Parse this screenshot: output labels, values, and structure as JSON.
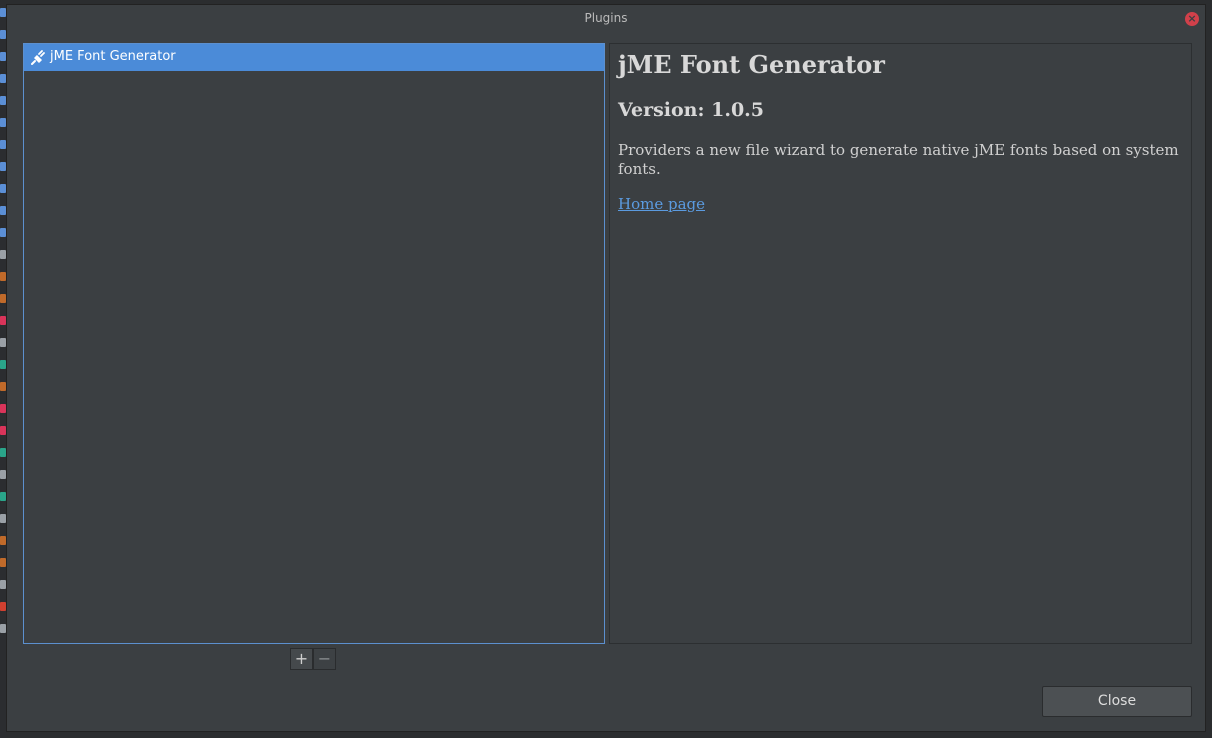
{
  "window": {
    "title": "Plugins",
    "close_icon_glyph": "×"
  },
  "plugin_list": {
    "items": [
      {
        "label": "jME Font Generator",
        "icon": "plug-icon",
        "selected": true
      }
    ]
  },
  "details": {
    "name": "jME Font Generator",
    "version": "Version: 1.0.5",
    "description": "Providers a new file wizard to generate native jME fonts based on system fonts.",
    "home_link": "Home page"
  },
  "toolbar": {
    "add_label": "+",
    "remove_label": "−"
  },
  "footer": {
    "close_label": "Close"
  },
  "colors": {
    "background": "#3b3f42",
    "selection": "#4b8bd8",
    "link": "#5b9be0",
    "close_icon": "#d0404a"
  }
}
